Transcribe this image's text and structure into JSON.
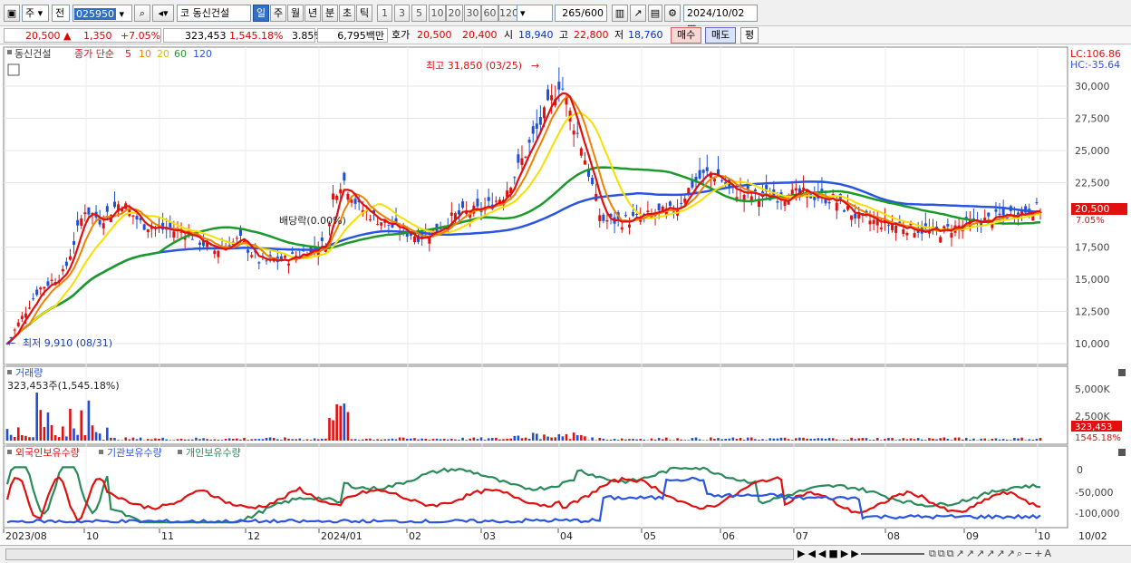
{
  "toolbar": {
    "market_type": "주",
    "prev_label": "전",
    "code": "025950",
    "stock_prefix": "코",
    "stock_name": "동신건설",
    "periods": [
      "일",
      "주",
      "월",
      "년",
      "분",
      "초",
      "틱"
    ],
    "active_period": "일",
    "intervals": [
      "1",
      "3",
      "5",
      "10",
      "20",
      "30",
      "60",
      "120"
    ],
    "count": "265",
    "count_total": "/600",
    "date": "2024/10/02"
  },
  "quote": {
    "price": "20,500",
    "change_arrow": "▲",
    "change": "1,350",
    "change_pct": "+7.05%",
    "volume": "323,453",
    "volume_pct": "1,545.18%",
    "turnover_pct": "3.85%",
    "amount": "6,795백만",
    "ask_label": "호가",
    "ask": "20,500",
    "bid": "20,400",
    "open_label": "시",
    "open": "18,940",
    "high_label": "고",
    "high": "22,800",
    "low_label": "저",
    "low": "18,760",
    "buy_label": "매수",
    "sell_label": "매도",
    "eval_label": "평"
  },
  "price_panel": {
    "legend_name": "동신건설",
    "legend_series": "종가 단순",
    "ma_periods": [
      "5",
      "10",
      "20",
      "60",
      "120"
    ],
    "lc": "LC:106.86",
    "hc": "HC:-35.64",
    "high_annotation": "최고 31,850 (03/25)",
    "low_annotation": "최저 9,910 (08/31)",
    "dividend_annotation": "배당락(0.00%)",
    "last_price_tag": "20,500",
    "last_pct_tag": "7.05%",
    "y_ticks": [
      "30,000",
      "27,500",
      "25,000",
      "22,500",
      "17,500",
      "15,000",
      "12,500",
      "10,000"
    ]
  },
  "volume_panel": {
    "title": "거래량",
    "value_text": "323,453주(1,545.18%)",
    "y_ticks": [
      "5,000K",
      "2,500K"
    ],
    "last_tag": "323,453",
    "last_pct_tag": "1545.18%"
  },
  "holding_panel": {
    "series_labels": [
      "외국인보유수량",
      "기관보유수량",
      "개인보유수량"
    ],
    "y_ticks": [
      "0",
      "-50,000",
      "-100,000"
    ]
  },
  "x_axis": {
    "labels": [
      "2023/08",
      "10",
      "11",
      "12",
      "2024/01",
      "02",
      "03",
      "04",
      "05",
      "06",
      "07",
      "08",
      "09",
      "10",
      "10/02"
    ]
  },
  "colors": {
    "candle_up": "#e01010",
    "candle_down": "#1f4fd8",
    "ma5": "#e01010",
    "ma10": "#f08000",
    "ma20": "#f5e000",
    "ma60": "#1a9a2a",
    "ma120": "#2a55e0",
    "foreign": "#e01010",
    "institution": "#2a55e0",
    "individual": "#2a8a5a"
  }
}
